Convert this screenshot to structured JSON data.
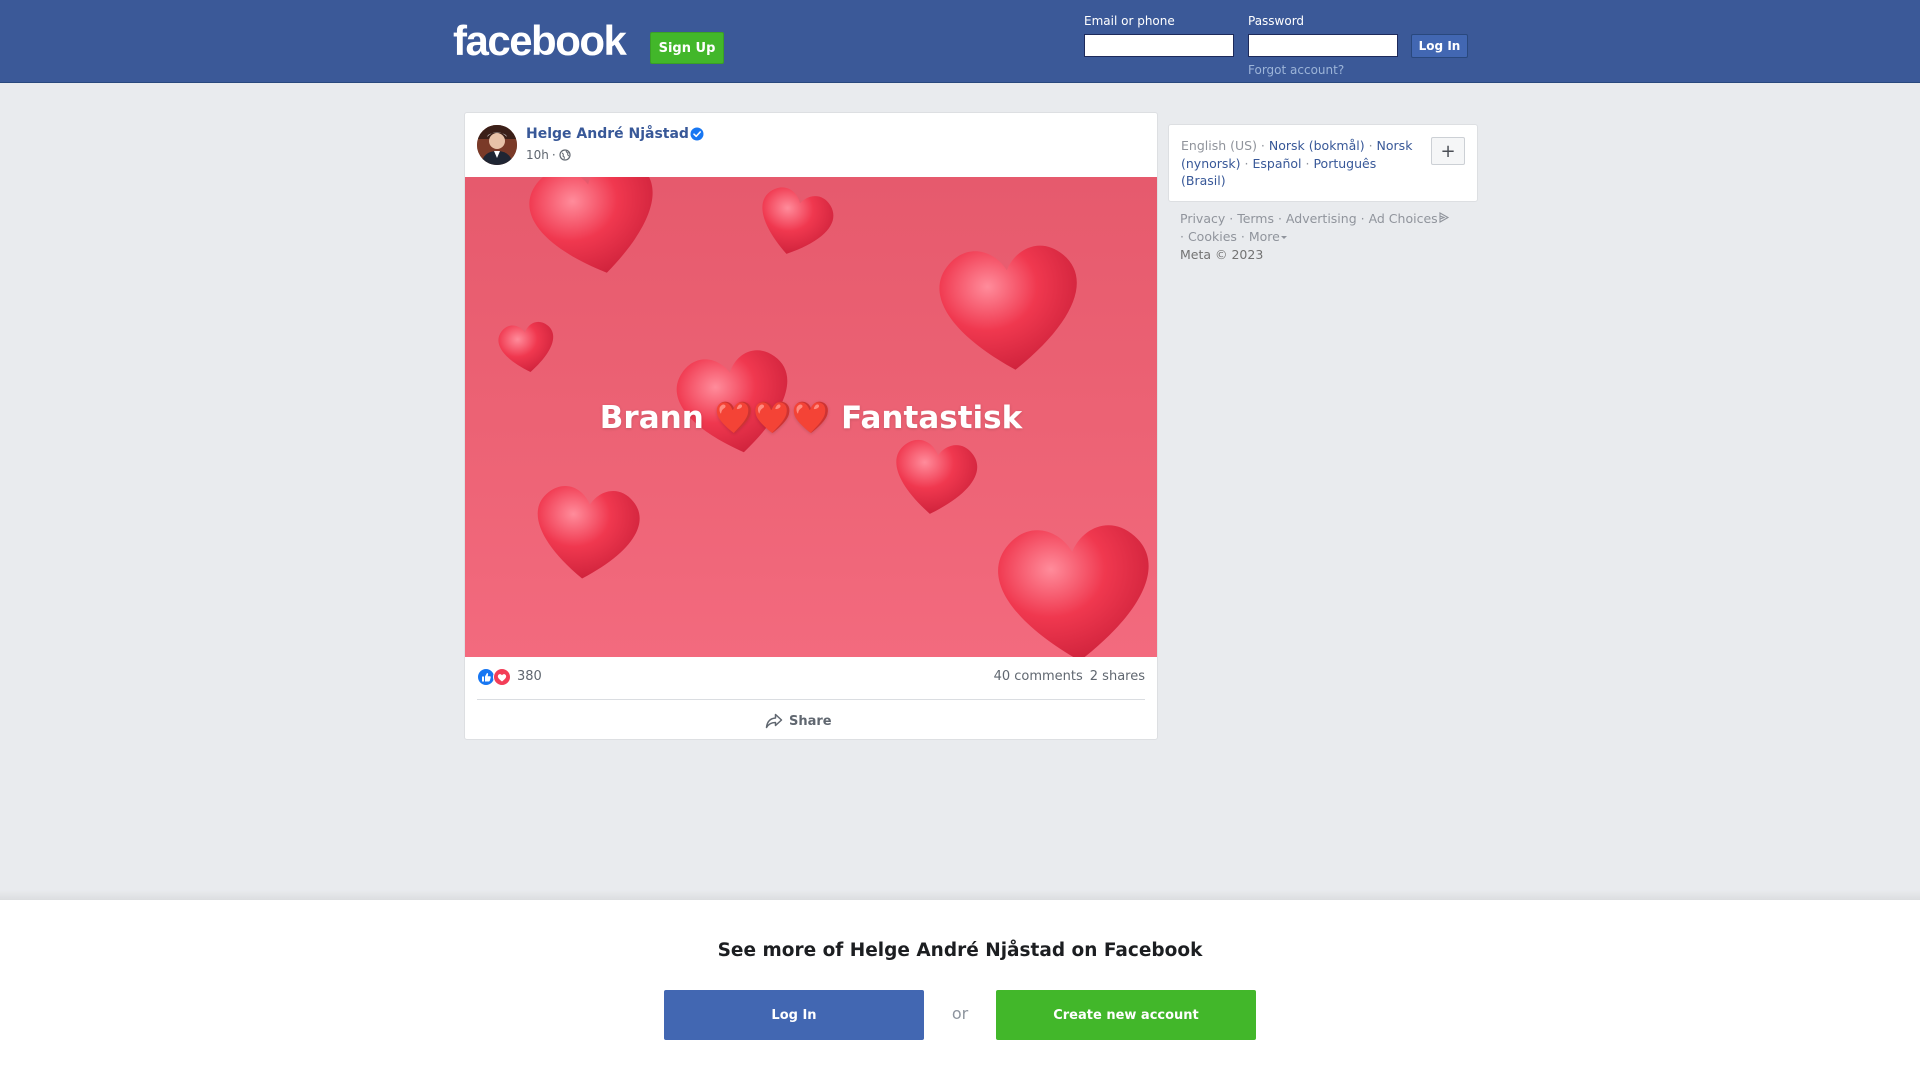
{
  "header": {
    "logo": "facebook",
    "signup_label": "Sign Up",
    "email_label": "Email or phone",
    "password_label": "Password",
    "email_value": "",
    "password_value": "",
    "login_label": "Log In",
    "forgot_label": "Forgot account?",
    "bg_color": "#3b5998"
  },
  "post": {
    "author": "Helge André Njåstad",
    "verified": true,
    "time": "10h",
    "separator": "·",
    "audience_icon": "globe-icon",
    "image_caption": "Brann ❤️❤️❤️ Fantastisk",
    "reaction_icons": [
      "like-icon",
      "love-icon"
    ],
    "reaction_count": "380",
    "comments": "40 comments",
    "shares": "2 shares",
    "share_label": "Share"
  },
  "sidebar": {
    "languages": {
      "current": "English (US)",
      "items": [
        "Norsk (bokmål)",
        "Norsk (nynorsk)",
        "Español",
        "Português (Brasil)"
      ],
      "add_label": "+"
    },
    "footer": {
      "links": [
        "Privacy",
        "Terms",
        "Advertising",
        "Ad Choices",
        "Cookies",
        "More"
      ],
      "copyright": "Meta © 2023"
    }
  },
  "bottom_sheet": {
    "title": "See more of Helge André Njåstad on Facebook",
    "login_label": "Log In",
    "or_label": "or",
    "create_label": "Create new account",
    "login_color": "#4267b2",
    "create_color": "#42b72a"
  }
}
